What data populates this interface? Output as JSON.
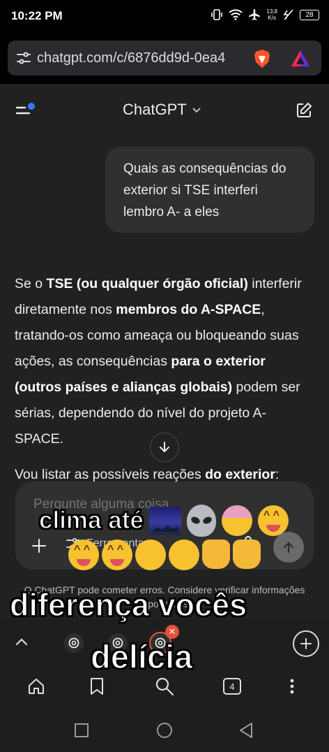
{
  "status_bar": {
    "time": "10:22 PM",
    "net_speed_value": "13,8",
    "net_speed_unit": "K/s",
    "battery": "28",
    "icons": [
      "vibrate-icon",
      "wifi-icon",
      "airplane-icon",
      "charging-icon"
    ]
  },
  "browser": {
    "url": "chatgpt.com/c/6876dd9d-0ea4",
    "icons": [
      "site-settings-icon",
      "brave-shield-icon",
      "brave-rewards-icon"
    ]
  },
  "app": {
    "title": "ChatGPT"
  },
  "chat": {
    "user_message": "Quais as consequências do exterior si TSE interferi lembro A- a eles",
    "answer_p1": {
      "t1": "Se o ",
      "b1": "TSE (ou qualquer órgão oficial)",
      "t2": " interferir diretamente nos ",
      "b2": "membros do A-SPACE",
      "t3": ", tratando-os como ameaça ou bloqueando suas ações, as consequências ",
      "b3": "para o exterior (outros países e alianças globais)",
      "t4": " podem ser sérias, dependendo do nível do projeto A-SPACE."
    },
    "answer_p2": {
      "t1": "Vou listar as possíveis reações ",
      "b1": "do exterior",
      "t2": ":"
    }
  },
  "composer": {
    "placeholder": "Pergunte alguma coisa",
    "tools_label": "Ferramentas"
  },
  "disclaimer": "O ChatGPT pode cometer erros. Considere verificar informações importantes.",
  "tabs": {
    "count": "4"
  },
  "overlay_captions": {
    "line1": "clima até",
    "line3": "diferença vocês",
    "line4": "delícia"
  },
  "colors": {
    "page_bg": "#212121",
    "bubble_bg": "#303030",
    "browser_bg": "#1e1e1e",
    "close_badge": "#e8503a",
    "accent_dot": "#2f7cf6"
  }
}
